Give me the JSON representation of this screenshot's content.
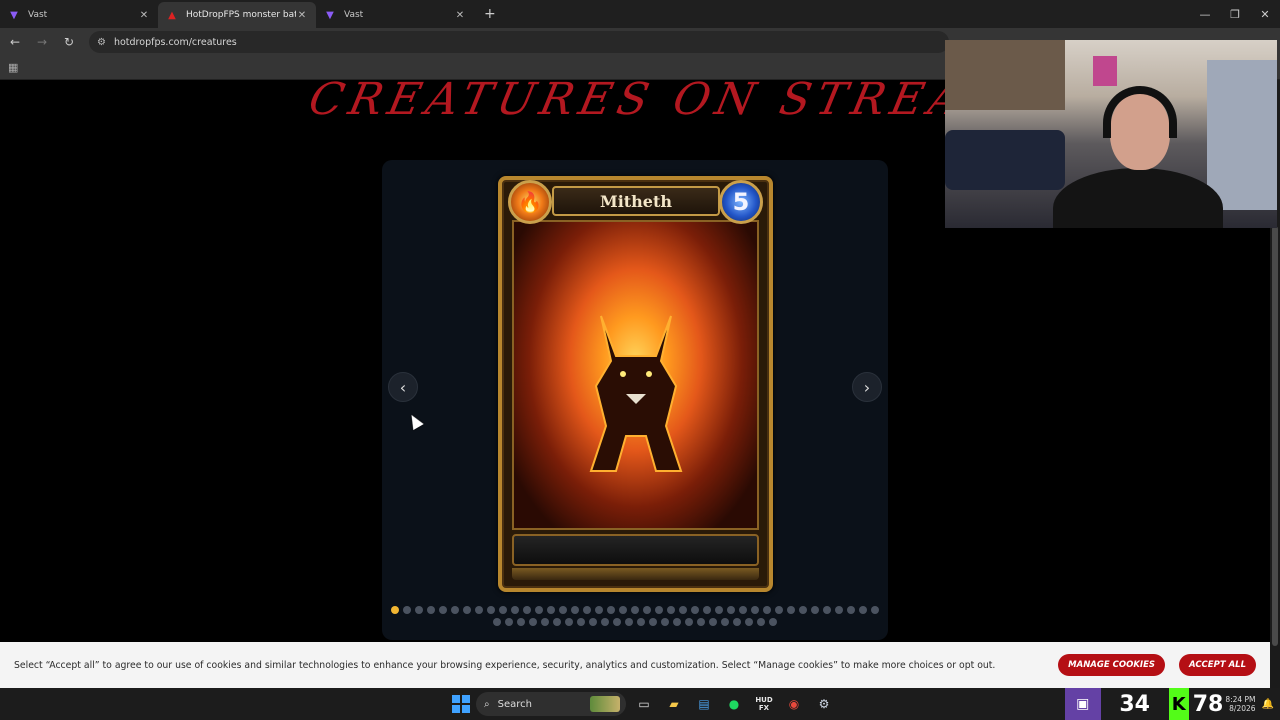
{
  "browser": {
    "tabs": [
      {
        "title": "Vast",
        "active": false
      },
      {
        "title": "HotDropFPS monster battle sty",
        "active": true
      },
      {
        "title": "Vast",
        "active": false
      }
    ],
    "url": "hotdropfps.com/creatures"
  },
  "page": {
    "banner_text": "CREATURES ON STREAM",
    "carousel": {
      "prev_label": "‹",
      "next_label": "›",
      "total_dots": 65,
      "active_index": 0
    },
    "card": {
      "name": "Mitheth",
      "cost": "5",
      "element_icon": "fire-icon"
    }
  },
  "cookie_banner": {
    "message": "Select “Accept all” to agree to our use of cookies and similar technologies to enhance your browsing experience, security, analytics and customization. Select “Manage cookies” to make more choices or opt out.",
    "manage_label": "MANAGE COOKIES",
    "accept_label": "ACCEPT ALL"
  },
  "taskbar": {
    "search_label": "Search",
    "viewer_count": "34",
    "temperature": "78",
    "clock_time": "8:24 PM",
    "clock_date": "8/2026"
  },
  "colors": {
    "accent_red": "#b50f14",
    "dot_active": "#f2b632",
    "twitch": "#6441a5",
    "kick": "#53fc18"
  }
}
